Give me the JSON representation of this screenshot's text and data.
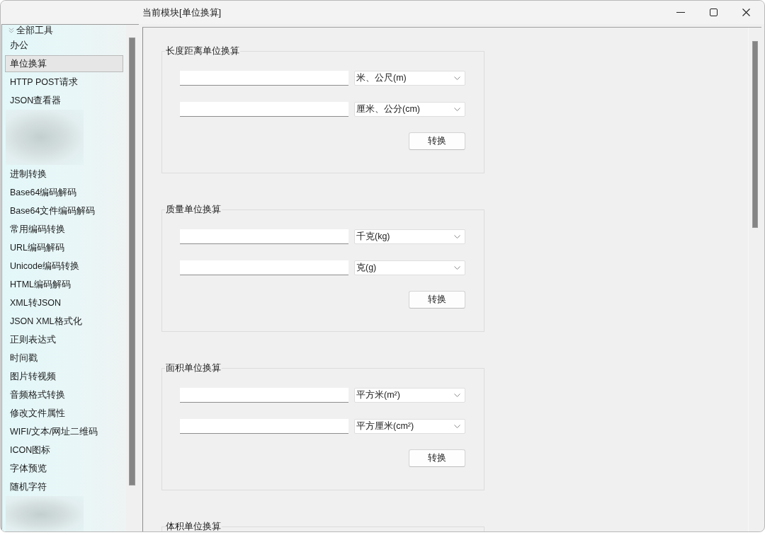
{
  "window": {
    "title": "当前模块[单位换算]"
  },
  "sidebar": {
    "header": {
      "label": "全部工具",
      "expanded": true
    },
    "items": [
      {
        "kind": "tool",
        "label": "办公",
        "selected": false
      },
      {
        "kind": "tool",
        "label": "单位换算",
        "selected": true
      },
      {
        "kind": "tool",
        "label": "HTTP POST请求",
        "selected": false
      },
      {
        "kind": "tool",
        "label": "JSON查看器",
        "selected": false
      },
      {
        "kind": "redacted",
        "selected": false
      },
      {
        "kind": "redacted",
        "selected": false
      },
      {
        "kind": "redacted",
        "selected": false
      },
      {
        "kind": "tool",
        "label": "进制转换",
        "selected": false
      },
      {
        "kind": "tool",
        "label": "Base64编码解码",
        "selected": false
      },
      {
        "kind": "tool",
        "label": "Base64文件编码解码",
        "selected": false
      },
      {
        "kind": "tool",
        "label": "常用编码转换",
        "selected": false
      },
      {
        "kind": "tool",
        "label": "URL编码解码",
        "selected": false
      },
      {
        "kind": "tool",
        "label": "Unicode编码转换",
        "selected": false
      },
      {
        "kind": "tool",
        "label": "HTML编码解码",
        "selected": false
      },
      {
        "kind": "tool",
        "label": "XML转JSON",
        "selected": false
      },
      {
        "kind": "tool",
        "label": "JSON XML格式化",
        "selected": false
      },
      {
        "kind": "tool",
        "label": "正则表达式",
        "selected": false
      },
      {
        "kind": "tool",
        "label": "时间戳",
        "selected": false
      },
      {
        "kind": "tool",
        "label": "图片转视频",
        "selected": false
      },
      {
        "kind": "tool",
        "label": "音频格式转换",
        "selected": false
      },
      {
        "kind": "tool",
        "label": "修改文件属性",
        "selected": false
      },
      {
        "kind": "tool",
        "label": "WIFI/文本/网址二维码",
        "selected": false
      },
      {
        "kind": "tool",
        "label": "ICON图标",
        "selected": false
      },
      {
        "kind": "tool",
        "label": "字体预览",
        "selected": false
      },
      {
        "kind": "tool",
        "label": "随机字符",
        "selected": false
      },
      {
        "kind": "redacted",
        "selected": false
      },
      {
        "kind": "redacted",
        "selected": false
      }
    ]
  },
  "groups": [
    {
      "title": "长度距离单位换算",
      "rows": [
        {
          "unit": "米、公尺(m)"
        },
        {
          "unit": "厘米、公分(cm)"
        }
      ],
      "button": "转换"
    },
    {
      "title": "质量单位换算",
      "rows": [
        {
          "unit": "千克(kg)"
        },
        {
          "unit": "克(g)"
        }
      ],
      "button": "转换"
    },
    {
      "title": "面积单位换算",
      "rows": [
        {
          "unit": "平方米(m²)"
        },
        {
          "unit": "平方厘米(cm²)"
        }
      ],
      "button": "转换"
    },
    {
      "title": "体积单位换算"
    }
  ]
}
